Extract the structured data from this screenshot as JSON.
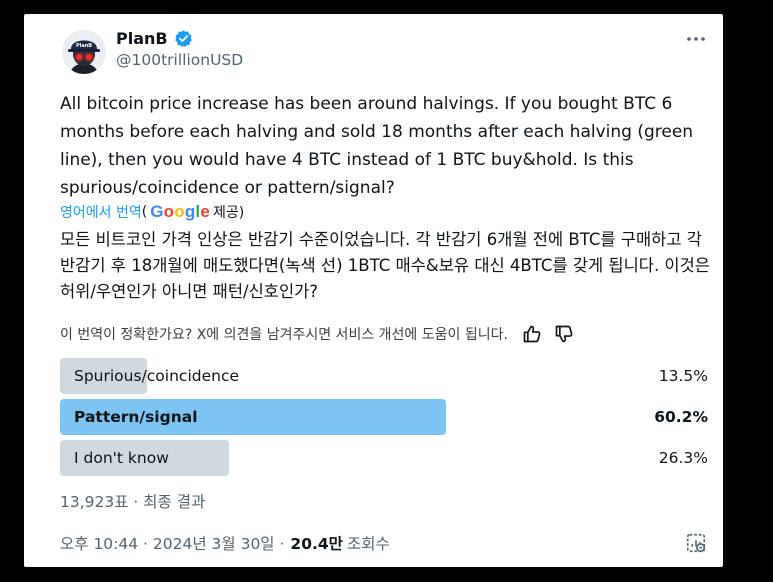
{
  "author": {
    "display_name": "PlanB",
    "handle": "@100trillionUSD",
    "avatar_text": "PlanB"
  },
  "tweet": {
    "text": "All bitcoin price increase has been around halvings. If you bought BTC 6 months before each halving and sold 18 months after each halving (green line), then you would have 4 BTC instead of 1 BTC buy&hold. Is this spurious/coincidence or pattern/signal?",
    "translate_link": "영어에서 번역",
    "translate_open": "(",
    "translate_provider": "Google",
    "translate_suffix": "제공)",
    "translated_text": "모든 비트코인 가격 인상은 반감기 수준이었습니다. 각 반감기 6개월 전에 BTC를 구매하고 각 반감기 후 18개월에 매도했다면(녹색 선) 1BTC 매수&보유 대신 4BTC를 갖게 됩니다. 이것은 허위/우연인가 아니면 패턴/신호인가?",
    "feedback_prompt": "이 번역이 정확한가요? X에 의견을 남겨주시면 서비스 개선에 도움이 됩니다."
  },
  "poll": {
    "options": [
      {
        "label": "Spurious/coincidence",
        "percent_text": "13.5%",
        "percent": 13.5,
        "winner": false
      },
      {
        "label": "Pattern/signal",
        "percent_text": "60.2%",
        "percent": 60.2,
        "winner": true
      },
      {
        "label": "I don't know",
        "percent_text": "26.3%",
        "percent": 26.3,
        "winner": false
      }
    ],
    "votes_text": "13,923표 · 최종 결과"
  },
  "meta": {
    "timestamp": "오후 10:44 · 2024년 3월 30일 ·",
    "views": "20.4만",
    "views_label": "조회수"
  },
  "colors": {
    "accent": "#1d9bf0",
    "winner_bar": "#7dc4f2",
    "loser_bar": "#cfd9de",
    "secondary_text": "#536471"
  },
  "icons": [
    "verified-badge-icon",
    "more-icon",
    "thumbs-up-icon",
    "thumbs-down-icon",
    "analytics-icon"
  ]
}
